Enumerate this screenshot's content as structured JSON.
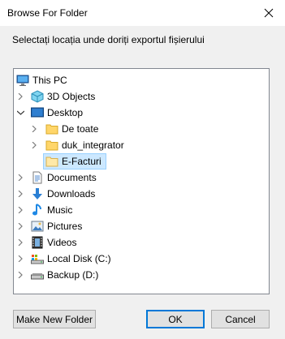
{
  "dialog": {
    "title": "Browse For Folder",
    "instruction": "Selectați locația unde doriți exportul fișierului"
  },
  "tree": {
    "root": "This PC",
    "items": [
      {
        "label": "3D Objects",
        "icon": "3d-objects-icon"
      },
      {
        "label": "Desktop",
        "icon": "desktop-icon"
      },
      {
        "label": "De toate",
        "icon": "folder-icon"
      },
      {
        "label": "duk_integrator",
        "icon": "folder-icon"
      },
      {
        "label": "E-Facturi",
        "icon": "folder-icon"
      },
      {
        "label": "Documents",
        "icon": "documents-icon"
      },
      {
        "label": "Downloads",
        "icon": "downloads-icon"
      },
      {
        "label": "Music",
        "icon": "music-icon"
      },
      {
        "label": "Pictures",
        "icon": "pictures-icon"
      },
      {
        "label": "Videos",
        "icon": "videos-icon"
      },
      {
        "label": "Local Disk (C:)",
        "icon": "local-disk-icon"
      },
      {
        "label": "Backup (D:)",
        "icon": "drive-icon"
      }
    ]
  },
  "buttons": {
    "new_folder": "Make New Folder",
    "ok": "OK",
    "cancel": "Cancel"
  },
  "colors": {
    "selection": "#cce8ff",
    "accent": "#0078d7",
    "folder": "#ffd66a"
  }
}
